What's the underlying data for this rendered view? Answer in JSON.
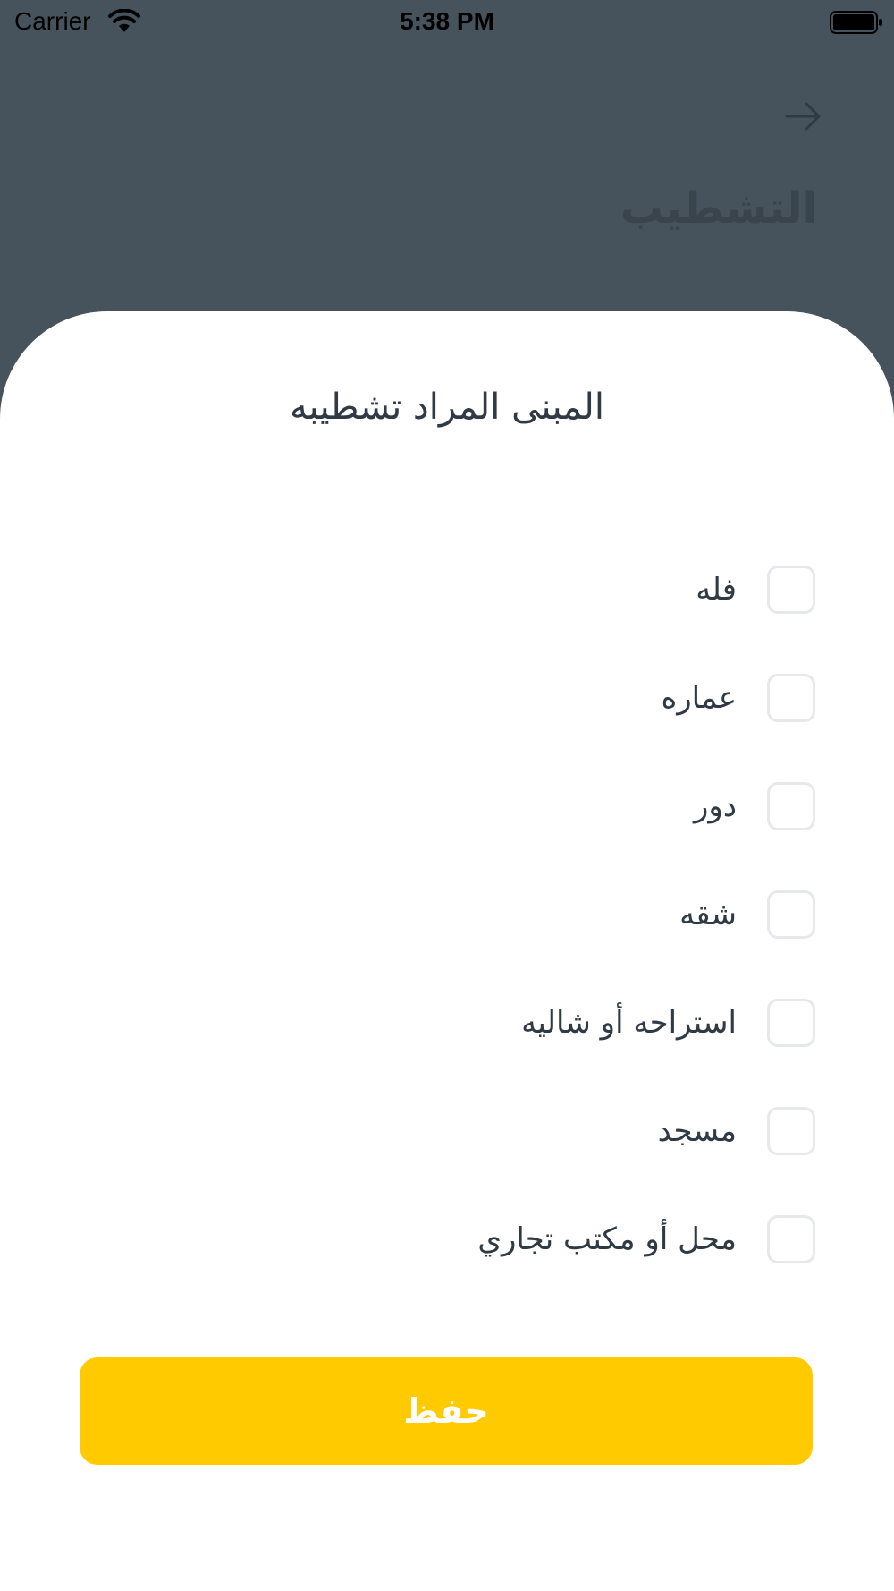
{
  "status_bar": {
    "carrier": "Carrier",
    "time": "5:38 PM"
  },
  "header": {
    "title": "التشطيب",
    "back_icon": "arrow-right-icon"
  },
  "sheet": {
    "title": "المبنى المراد تشطيبه",
    "options": [
      {
        "label": "فله",
        "checked": false
      },
      {
        "label": "عماره",
        "checked": false
      },
      {
        "label": "دور",
        "checked": false
      },
      {
        "label": "شقه",
        "checked": false
      },
      {
        "label": "استراحه أو شاليه",
        "checked": false
      },
      {
        "label": "مسجد",
        "checked": false
      },
      {
        "label": "محل أو مكتب تجاري",
        "checked": false
      }
    ],
    "save_label": "حفظ"
  },
  "colors": {
    "backdrop": "#47535c",
    "accent": "#ffcb00",
    "text": "#2f3a44",
    "checkbox_border": "#e6e8ec"
  }
}
